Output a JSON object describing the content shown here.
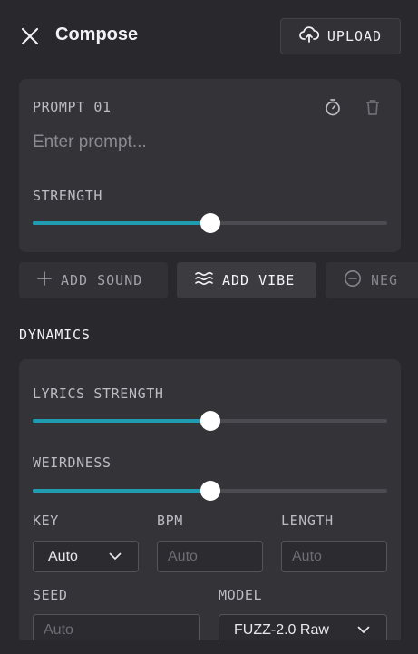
{
  "header": {
    "title": "Compose",
    "upload_label": "UPLOAD"
  },
  "prompt_card": {
    "label": "PROMPT 01",
    "placeholder": "Enter prompt...",
    "strength_label": "STRENGTH",
    "strength_value": 0.5
  },
  "chips": {
    "add_sound": "ADD SOUND",
    "add_vibe": "ADD VIBE",
    "negative": "NEG"
  },
  "dynamics": {
    "title": "DYNAMICS",
    "lyrics_strength_label": "LYRICS STRENGTH",
    "lyrics_strength_value": 0.5,
    "weirdness_label": "WEIRDNESS",
    "weirdness_value": 0.5,
    "key_label": "KEY",
    "key_value": "Auto",
    "bpm_label": "BPM",
    "bpm_placeholder": "Auto",
    "length_label": "LENGTH",
    "length_placeholder": "Auto",
    "seed_label": "SEED",
    "seed_placeholder": "Auto",
    "model_label": "MODEL",
    "model_value": "FUZZ-2.0 Raw"
  },
  "colors": {
    "accent": "#1f9cb0",
    "background": "#29282c",
    "card": "#343338"
  },
  "icons": [
    "close-icon",
    "cloud-upload-icon",
    "timer-icon",
    "trash-icon",
    "plus-icon",
    "waves-icon",
    "minus-circle-icon",
    "chevron-down-icon"
  ]
}
